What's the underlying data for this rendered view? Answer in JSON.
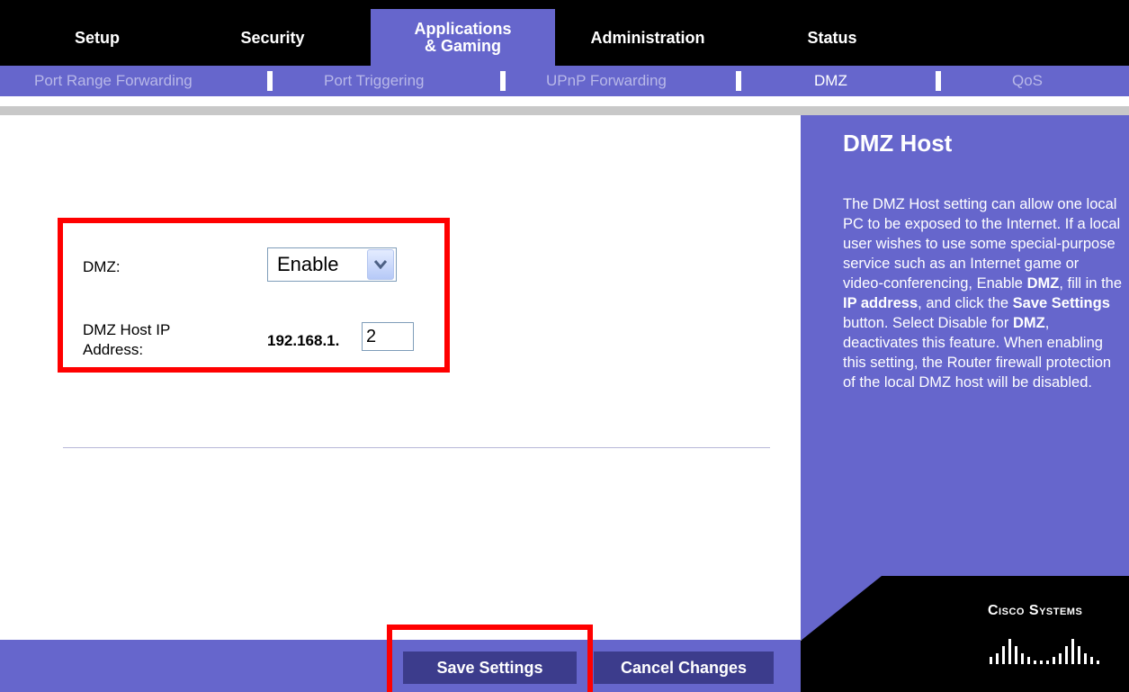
{
  "top_tabs": [
    {
      "label": "Setup"
    },
    {
      "label": "Security"
    },
    {
      "label_line1": "Applications",
      "label_line2": "& Gaming"
    },
    {
      "label": "Administration"
    },
    {
      "label": "Status"
    }
  ],
  "sub_tabs": [
    {
      "label": "Port Range Forwarding"
    },
    {
      "label": "Port Triggering"
    },
    {
      "label": "UPnP Forwarding"
    },
    {
      "label": "DMZ"
    },
    {
      "label": "QoS"
    }
  ],
  "form": {
    "dmz_label": "DMZ:",
    "dmz_value": "Enable",
    "host_ip_label_line1": "DMZ Host IP",
    "host_ip_label_line2": "Address:",
    "ip_prefix": "192.168.1.",
    "ip_last_octet": "2"
  },
  "help": {
    "title": "DMZ Host",
    "p1": "The DMZ Host setting can allow one local PC to be exposed to the Internet. If a local user wishes to use some special-purpose service such as an Internet game or video-conferencing, Enable ",
    "b1": "DMZ",
    "p2": ", fill in the ",
    "b2": "IP address",
    "p3": ", and click the ",
    "b3": "Save Settings",
    "p4": " button. Select Disable for ",
    "b4": "DMZ",
    "p5": ", deactivates this feature. When enabling this setting, the Router firewall protection of the local DMZ host will be disabled."
  },
  "buttons": {
    "save": "Save Settings",
    "cancel": "Cancel Changes"
  },
  "logo": {
    "text": "Cisco Systems"
  },
  "colors": {
    "nav_black": "#000000",
    "accent_purple": "#6666cc",
    "button_dark": "#3c3c8c",
    "highlight_red": "#ff0000"
  }
}
